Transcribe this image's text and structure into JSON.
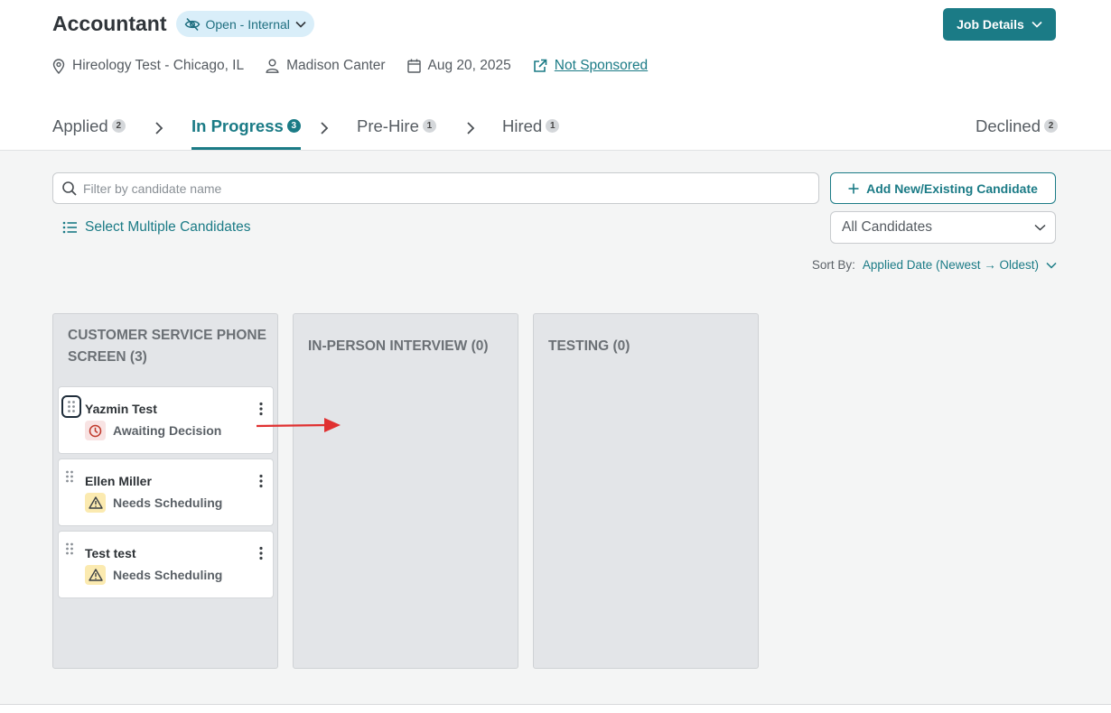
{
  "job": {
    "title": "Accountant",
    "status": "Open - Internal",
    "details_button": "Job Details"
  },
  "meta": {
    "location": "Hireology Test - Chicago, IL",
    "recruiter": "Madison Canter",
    "date": "Aug 20, 2025",
    "sponsorship": "Not Sponsored"
  },
  "tabs": [
    {
      "label": "Applied",
      "count": "2"
    },
    {
      "label": "In Progress",
      "count": "3"
    },
    {
      "label": "Pre-Hire",
      "count": "1"
    },
    {
      "label": "Hired",
      "count": "1"
    },
    {
      "label": "Declined",
      "count": "2"
    }
  ],
  "active_tab": "In Progress",
  "search": {
    "placeholder": "Filter by candidate name"
  },
  "add_button": "Add New/Existing Candidate",
  "select_multiple": "Select Multiple Candidates",
  "filter": {
    "selected": "All Candidates"
  },
  "sort": {
    "label": "Sort By:",
    "value": "Applied Date (Newest → Oldest)"
  },
  "columns": [
    {
      "title": "CUSTOMER SERVICE PHONE SCREEN (3)",
      "cards": [
        {
          "name": "Yazmin Test",
          "status": "Awaiting Decision",
          "status_icon": "clock-icon"
        },
        {
          "name": "Ellen Miller",
          "status": "Needs Scheduling",
          "status_icon": "warning-icon"
        },
        {
          "name": "Test test",
          "status": "Needs Scheduling",
          "status_icon": "warning-icon"
        }
      ]
    },
    {
      "title": "IN-PERSON INTERVIEW (0)",
      "cards": []
    },
    {
      "title": "TESTING (0)",
      "cards": []
    }
  ],
  "colors": {
    "accent": "#1b7b86",
    "status_pill_bg": "#d9eef9",
    "awaiting_red": "#c0392b",
    "warning_yellow": "#fbeab0",
    "annotation_arrow": "#e03131"
  }
}
